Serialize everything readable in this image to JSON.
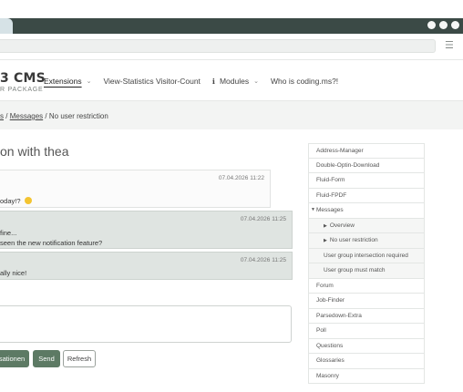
{
  "browser": {
    "menu_icon": "hamburger-icon"
  },
  "header": {
    "logo_main": "3 CMS",
    "logo_sub": "R PACKAGE",
    "nav": [
      {
        "label": "Extensions",
        "active": true,
        "dropdown": true
      },
      {
        "label": "View-Statistics Visitor-Count",
        "active": false,
        "dropdown": false
      },
      {
        "label": "Modules",
        "active": false,
        "dropdown": true,
        "icon": "info-icon"
      },
      {
        "label": "Who is coding.ms?!",
        "active": false,
        "dropdown": false
      }
    ]
  },
  "breadcrumb": {
    "item1": "s",
    "sep1": "/",
    "item2": "Messages",
    "sep2": "/",
    "item3": "No user restriction"
  },
  "main": {
    "title": "on with thea",
    "messages": [
      {
        "date": "07.04.2026 11:22",
        "lines": [
          "oday!? "
        ],
        "emoji": "smiley-icon"
      },
      {
        "date": "07.04.2026 11:25",
        "lines": [
          "fine...",
          "seen the new notification feature?"
        ]
      },
      {
        "date": "07.04.2026 11:25",
        "lines": [
          "ally nice!"
        ]
      }
    ],
    "buttons": {
      "conversations": "sationen",
      "send": "Send",
      "refresh": "Refresh"
    }
  },
  "sidebar": {
    "items": [
      {
        "label": "Address-Manager"
      },
      {
        "label": "Double-Optin-Download"
      },
      {
        "label": "Fluid-Form"
      },
      {
        "label": "Fluid-FPDF"
      },
      {
        "label": "Messages"
      },
      {
        "label": "Overview"
      },
      {
        "label": "No user restriction"
      },
      {
        "label": "User group intersection required"
      },
      {
        "label": "User group must match"
      },
      {
        "label": "Forum"
      },
      {
        "label": "Job-Finder"
      },
      {
        "label": "Parsedown-Extra"
      },
      {
        "label": "Poll"
      },
      {
        "label": "Questions"
      },
      {
        "label": "Glossaries"
      },
      {
        "label": "Masonry"
      }
    ]
  }
}
